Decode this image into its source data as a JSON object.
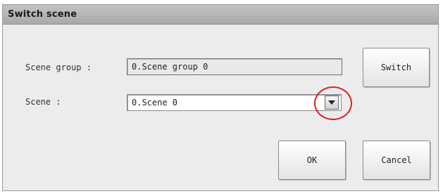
{
  "dialog": {
    "title": "Switch scene"
  },
  "form": {
    "scene_group_label": "Scene group :",
    "scene_group_value": "0.Scene group 0",
    "scene_label": "Scene :",
    "scene_value": "0.Scene 0"
  },
  "buttons": {
    "switch": "Switch",
    "ok": "OK",
    "cancel": "Cancel"
  },
  "icons": {
    "dropdown": "chevron-down-icon"
  },
  "colors": {
    "highlight": "#e02020",
    "titlebar": "#b5b5b5",
    "dialog_bg": "#ececec"
  }
}
